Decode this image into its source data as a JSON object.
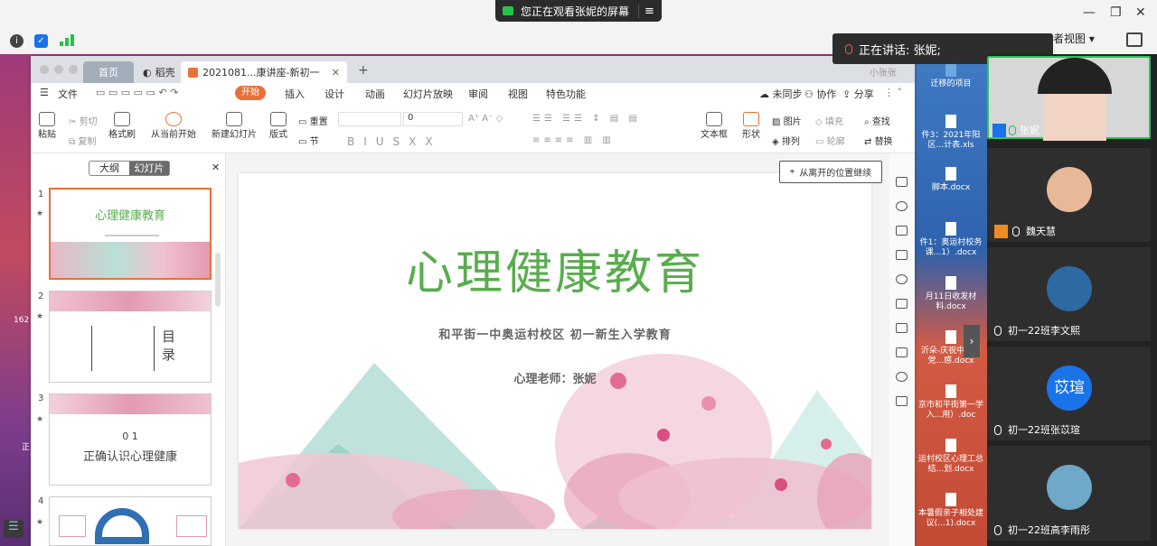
{
  "share_pill": {
    "text": "您正在观看张妮的屏幕"
  },
  "speaking": {
    "text": "正在讲话: 张妮;"
  },
  "view_selector": {
    "label": "者视图"
  },
  "desktop_files": [
    {
      "name": "迁移的项目"
    },
    {
      "name": "件3：2021年阳区...计表.xls"
    },
    {
      "name": "脚本.docx"
    },
    {
      "name": "件1：奥运村校务课...1）.docx"
    },
    {
      "name": "月11日收发材料.docx"
    },
    {
      "name": "沂朵-庆祝中国产党...感.docx"
    },
    {
      "name": "京市和平街第一学入...用）.doc"
    },
    {
      "name": "运村校区心理工总结...划.docx"
    },
    {
      "name": "本暑假亲子相处建议(...1).docx"
    }
  ],
  "left_desktop_labels": [
    "162",
    "正"
  ],
  "wps": {
    "tabs": {
      "home": "首页",
      "shell": "稻壳",
      "doc": "2021081...康讲座-新初一"
    },
    "user": "小张张",
    "menu": {
      "file": "文件",
      "start": "开始",
      "insert": "插入",
      "design": "设计",
      "animation": "动画",
      "slideshow": "幻灯片放映",
      "review": "审阅",
      "view": "视图",
      "special": "特色功能"
    },
    "menu_right": {
      "sync": "未同步",
      "collab": "协作",
      "share": "分享"
    },
    "ribbon": {
      "paste": "粘贴",
      "cut": "剪切",
      "copy": "复制",
      "format_painter": "格式刷",
      "from_current": "从当前开始",
      "new_slide": "新建幻灯片",
      "layout": "版式",
      "reset": "重置",
      "section": "节",
      "font_size": "0",
      "textbox": "文本框",
      "shape": "形状",
      "picture": "图片",
      "arrange": "排列",
      "fill": "填充",
      "outline": "轮廓",
      "find": "查找",
      "replace": "替换"
    },
    "panel": {
      "outline_tab": "大纲",
      "slides_tab": "幻灯片"
    },
    "thumbs": [
      {
        "num": "1",
        "title": "心理健康教育"
      },
      {
        "num": "2",
        "title": "目录"
      },
      {
        "num": "3",
        "title": "正确认识心理健康",
        "sub": "0 1"
      },
      {
        "num": "4",
        "title": ""
      }
    ],
    "slide": {
      "title": "心理健康教育",
      "subtitle": "和平街一中奥运村校区  初一新生入学教育",
      "teacher": "心理老师：张妮"
    },
    "resume_button": "从离开的位置继续"
  },
  "participants": [
    {
      "name": "张妮",
      "color": "#d7d7d7"
    },
    {
      "name": "魏天慧",
      "color": "#e8b999"
    },
    {
      "name": "初一22班李文熙",
      "color": "#2d6aa3"
    },
    {
      "name": "初一22班张苡瑄",
      "color": "#1a73e8",
      "initials": "苡瑄"
    },
    {
      "name": "初一22班高李雨彤",
      "color": "#6fa8c8"
    }
  ]
}
